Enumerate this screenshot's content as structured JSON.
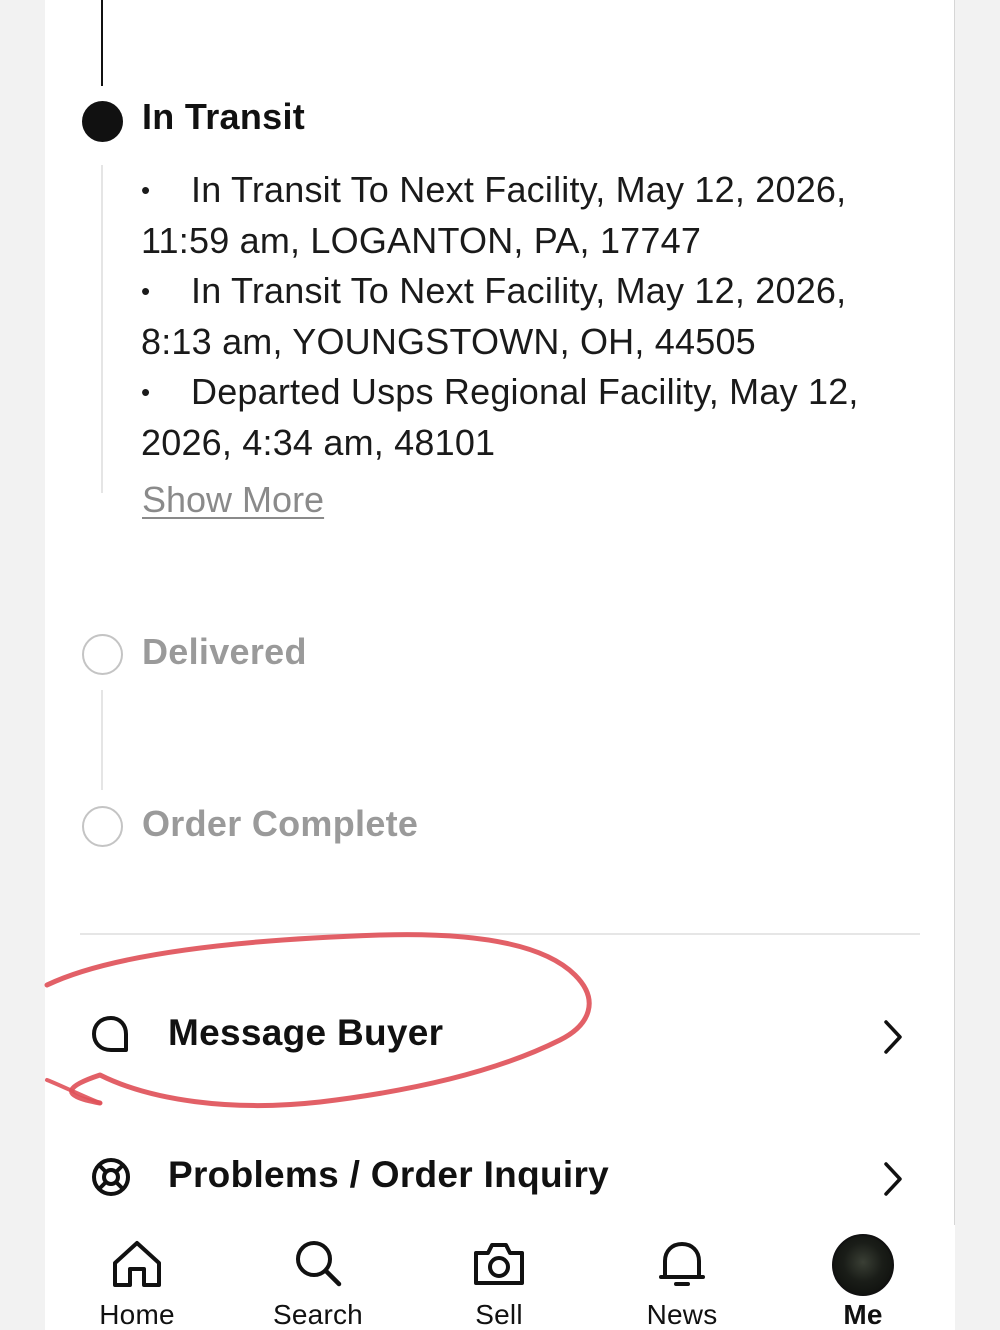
{
  "timeline": {
    "in_transit": {
      "title": "In Transit",
      "events": [
        {
          "line1": "In Transit To Next Facility, May 12, 2026,",
          "line2": "11:59 am, LOGANTON, PA, 17747"
        },
        {
          "line1": "In Transit To Next Facility, May 12, 2026,",
          "line2": "8:13 am, YOUNGSTOWN, OH, 44505"
        },
        {
          "line1": "Departed Usps Regional Facility, May 12,",
          "line2": "2026, 4:34 am, 48101"
        }
      ],
      "bullet": "•",
      "show_more": "Show More"
    },
    "delivered": {
      "title": "Delivered"
    },
    "order_complete": {
      "title": "Order Complete"
    }
  },
  "actions": [
    {
      "label": "Message Buyer",
      "icon": "chat-bubble-icon"
    },
    {
      "label": "Problems / Order Inquiry",
      "icon": "lifebuoy-icon"
    }
  ],
  "annotation": {
    "color": "#e0525a",
    "description_icon": "red-hand-drawn-circle"
  },
  "tabbar": {
    "tabs": [
      {
        "label": "Home",
        "icon": "home-icon"
      },
      {
        "label": "Search",
        "icon": "search-icon"
      },
      {
        "label": "Sell",
        "icon": "camera-icon"
      },
      {
        "label": "News",
        "icon": "bell-icon"
      },
      {
        "label": "Me",
        "icon": "avatar",
        "active": true
      }
    ]
  },
  "colors": {
    "text_primary": "#111111",
    "text_pending": "#9a9a9a",
    "link_muted": "#8a8a8a",
    "annotation_red": "#e0525a"
  }
}
